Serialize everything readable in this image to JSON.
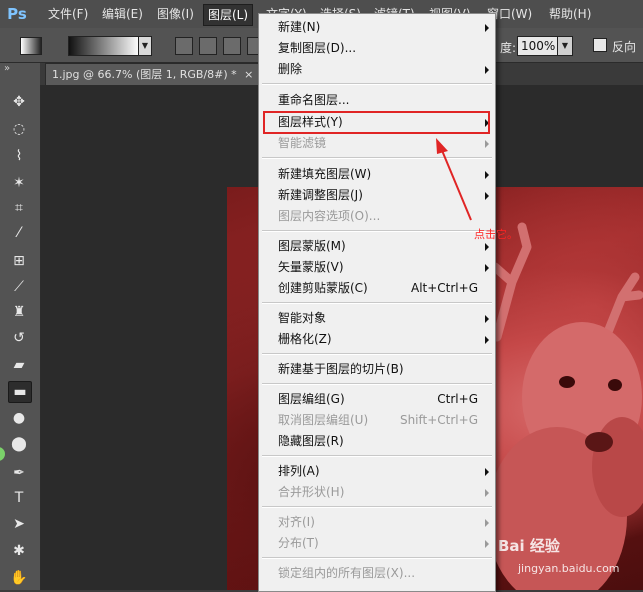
{
  "app": {
    "logo": "Ps",
    "menu": [
      "文件(F)",
      "编辑(E)",
      "图像(I)",
      "图层(L)",
      "文字(Y)",
      "选择(S)",
      "滤镜(T)",
      "视图(V)",
      "窗口(W)",
      "帮助(H)"
    ],
    "active_menu": "图层(L)"
  },
  "options_bar": {
    "opacity_label": "度:",
    "opacity_value": "100%",
    "reverse_label": "反向"
  },
  "document_tab": {
    "title": "1.jpg @ 66.7% (图层 1, RGB/8#) *",
    "close": "×"
  },
  "toolbar": {
    "collapse": "»",
    "tools": [
      "move-tool",
      "marquee-tool",
      "lasso-tool",
      "magic-wand-tool",
      "crop-tool",
      "eyedropper-tool",
      "healing-brush-tool",
      "brush-tool",
      "clone-stamp-tool",
      "history-brush-tool",
      "eraser-tool",
      "gradient-tool",
      "blur-tool",
      "dodge-tool",
      "pen-tool",
      "type-tool",
      "path-selection-tool",
      "custom-shape-tool",
      "hand-tool"
    ],
    "active_tool": "gradient-tool"
  },
  "layer_menu": {
    "items": [
      {
        "label": "新建(N)",
        "submenu": true,
        "disabled": false
      },
      {
        "label": "复制图层(D)...",
        "submenu": false,
        "disabled": false
      },
      {
        "label": "删除",
        "submenu": true,
        "disabled": false
      },
      {
        "separator": true
      },
      {
        "label": "重命名图层...",
        "submenu": false,
        "disabled": false
      },
      {
        "label": "图层样式(Y)",
        "submenu": true,
        "disabled": false,
        "highlighted": true
      },
      {
        "label": "智能滤镜",
        "submenu": true,
        "disabled": true
      },
      {
        "separator": true
      },
      {
        "label": "新建填充图层(W)",
        "submenu": true,
        "disabled": false
      },
      {
        "label": "新建调整图层(J)",
        "submenu": true,
        "disabled": false
      },
      {
        "label": "图层内容选项(O)...",
        "submenu": false,
        "disabled": true
      },
      {
        "separator": true
      },
      {
        "label": "图层蒙版(M)",
        "submenu": true,
        "disabled": false
      },
      {
        "label": "矢量蒙版(V)",
        "submenu": true,
        "disabled": false
      },
      {
        "label": "创建剪贴蒙版(C)",
        "shortcut": "Alt+Ctrl+G",
        "submenu": false,
        "disabled": false
      },
      {
        "separator": true
      },
      {
        "label": "智能对象",
        "submenu": true,
        "disabled": false
      },
      {
        "label": "栅格化(Z)",
        "submenu": true,
        "disabled": false
      },
      {
        "separator": true
      },
      {
        "label": "新建基于图层的切片(B)",
        "submenu": false,
        "disabled": false
      },
      {
        "separator": true
      },
      {
        "label": "图层编组(G)",
        "shortcut": "Ctrl+G",
        "submenu": false,
        "disabled": false
      },
      {
        "label": "取消图层编组(U)",
        "shortcut": "Shift+Ctrl+G",
        "submenu": false,
        "disabled": true
      },
      {
        "label": "隐藏图层(R)",
        "submenu": false,
        "disabled": false
      },
      {
        "separator": true
      },
      {
        "label": "排列(A)",
        "submenu": true,
        "disabled": false
      },
      {
        "label": "合并形状(H)",
        "submenu": true,
        "disabled": true
      },
      {
        "separator": true
      },
      {
        "label": "对齐(I)",
        "submenu": true,
        "disabled": true
      },
      {
        "label": "分布(T)",
        "submenu": true,
        "disabled": true
      },
      {
        "separator": true
      },
      {
        "label": "锁定组内的所有图层(X)...",
        "submenu": false,
        "disabled": true
      }
    ]
  },
  "annotation": {
    "text": "点击它。",
    "color": "#ff2424"
  },
  "watermark": {
    "brand": "Bai 经验",
    "url": "jingyan.baidu.com"
  },
  "colors": {
    "menu_bg": "#f0f0f0",
    "highlight_border": "#e02525",
    "ui_dark": "#535353"
  }
}
